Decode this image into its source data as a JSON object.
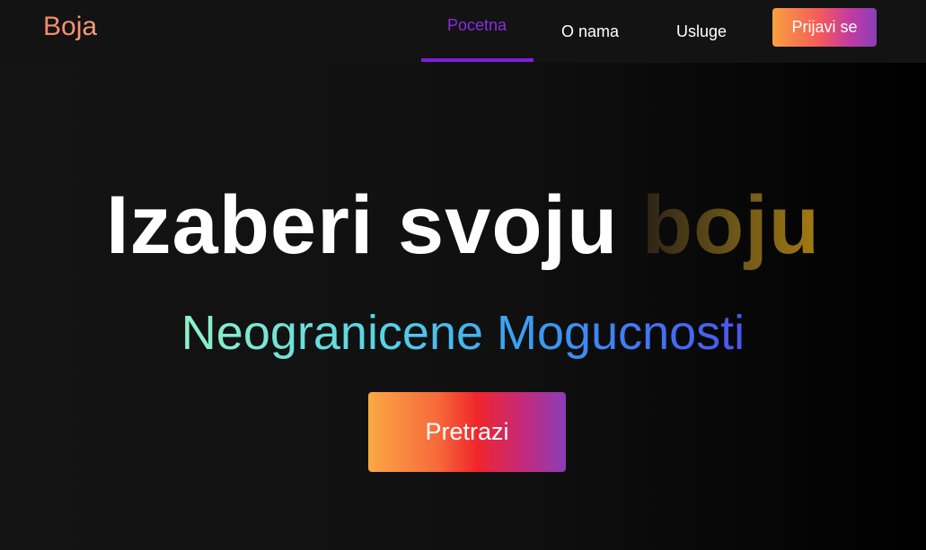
{
  "header": {
    "logo": "Boja",
    "nav": [
      {
        "label": "Pocetna",
        "active": true
      },
      {
        "label": "O nama",
        "active": false
      },
      {
        "label": "Usluge",
        "active": false
      }
    ],
    "login_label": "Prijavi se"
  },
  "hero": {
    "title_main": "Izaberi svoju",
    "title_accent": "boju",
    "subtitle": "Neogranicene Mogucnosti",
    "search_label": "Pretrazi"
  },
  "colors": {
    "active_nav": "#8a2be2",
    "background": "#111111",
    "text": "#ffffff"
  }
}
